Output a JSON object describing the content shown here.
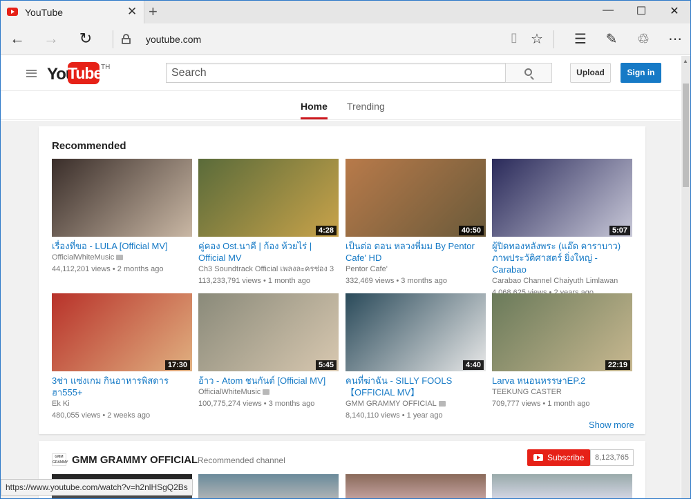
{
  "browser": {
    "tab_title": "YouTube",
    "url": "youtube.com",
    "status_url": "https://www.youtube.com/watch?v=h2nlHSgQ2Bs"
  },
  "header": {
    "logo_you": "You",
    "logo_tube": "Tube",
    "logo_region": "TH",
    "search_placeholder": "Search",
    "upload_label": "Upload",
    "signin_label": "Sign in"
  },
  "nav_tabs": [
    {
      "label": "Home"
    },
    {
      "label": "Trending"
    }
  ],
  "recommended": {
    "heading": "Recommended",
    "show_more": "Show more",
    "videos": [
      {
        "title": "เรื่องที่ขอ - LULA [Official MV]",
        "channel": "OfficialWhiteMusic",
        "verified": true,
        "views": "44,112,201 views",
        "age": "2 months ago",
        "duration": "",
        "thumb_colors": [
          "#3a2e2a",
          "#c9b7a4"
        ]
      },
      {
        "title": "คู่คอง Ost.นาคี | ก้อง ห้วยไร่ | Official MV",
        "channel": "Ch3 Soundtrack Official เพลงละครช่อง 3",
        "verified": false,
        "views": "113,233,791 views",
        "age": "1 month ago",
        "duration": "4:28",
        "thumb_colors": [
          "#5a6b3a",
          "#c9a34a"
        ]
      },
      {
        "title": "เป็นต่อ ตอน หลวงพี่มม By Pentor Cafe' HD",
        "channel": "Pentor Cafe'",
        "verified": false,
        "views": "332,469 views",
        "age": "3 months ago",
        "duration": "40:50",
        "thumb_colors": [
          "#b87a4a",
          "#6a5a3a"
        ]
      },
      {
        "title": "ผู้ปิดทองหลังพระ (แอ๊ด คาราบาว) ภาพประวัติศาสตร์ ยิ่งใหญ่ - Carabao",
        "channel": "Carabao Channel Chaiyuth Limlawan",
        "verified": false,
        "views": "4,068,625 views",
        "age": "2 years ago",
        "duration": "5:07",
        "thumb_colors": [
          "#2a2a5a",
          "#c8c8d8"
        ]
      },
      {
        "title": "3ช่า แซ่งเกม กินอาหารพิสดาร ฮา555+",
        "channel": "Ek Ki",
        "verified": false,
        "views": "480,055 views",
        "age": "2 weeks ago",
        "duration": "17:30",
        "thumb_colors": [
          "#b8322a",
          "#e0b080"
        ]
      },
      {
        "title": "อ้าว - Atom ชนกันต์ [Official MV]",
        "channel": "OfficialWhiteMusic",
        "verified": true,
        "views": "100,775,274 views",
        "age": "3 months ago",
        "duration": "5:45",
        "thumb_colors": [
          "#8a8a7a",
          "#d8c8b0"
        ]
      },
      {
        "title": "คนที่ฆ่าฉัน - SILLY FOOLS 【OFFICIAL MV】",
        "channel": "GMM GRAMMY OFFICIAL",
        "verified": true,
        "views": "8,140,110 views",
        "age": "1 year ago",
        "duration": "4:40",
        "thumb_colors": [
          "#2a4a5a",
          "#e8e8e8"
        ]
      },
      {
        "title": "Larva หนอนหรรษาEP.2",
        "channel": "TEEKUNG CASTER",
        "verified": false,
        "views": "709,777 views",
        "age": "1 month ago",
        "duration": "22:19",
        "thumb_colors": [
          "#6a7a5a",
          "#c8b890"
        ]
      }
    ]
  },
  "channel": {
    "logo_text": "GMM GRAMMY",
    "name": "GMM GRAMMY OFFICIAL",
    "tag": "Recommended channel",
    "subscribe_label": "Subscribe",
    "subscriber_count": "8,123,765"
  },
  "colors": {
    "accent_red": "#e62117",
    "link_blue": "#167ac6"
  },
  "icons": [
    "back-arrow-icon",
    "forward-arrow-icon",
    "refresh-icon",
    "lock-icon",
    "reading-view-icon",
    "favorite-star-icon",
    "hub-icon",
    "web-note-icon",
    "share-icon",
    "more-icon",
    "search-icon",
    "menu-icon"
  ]
}
